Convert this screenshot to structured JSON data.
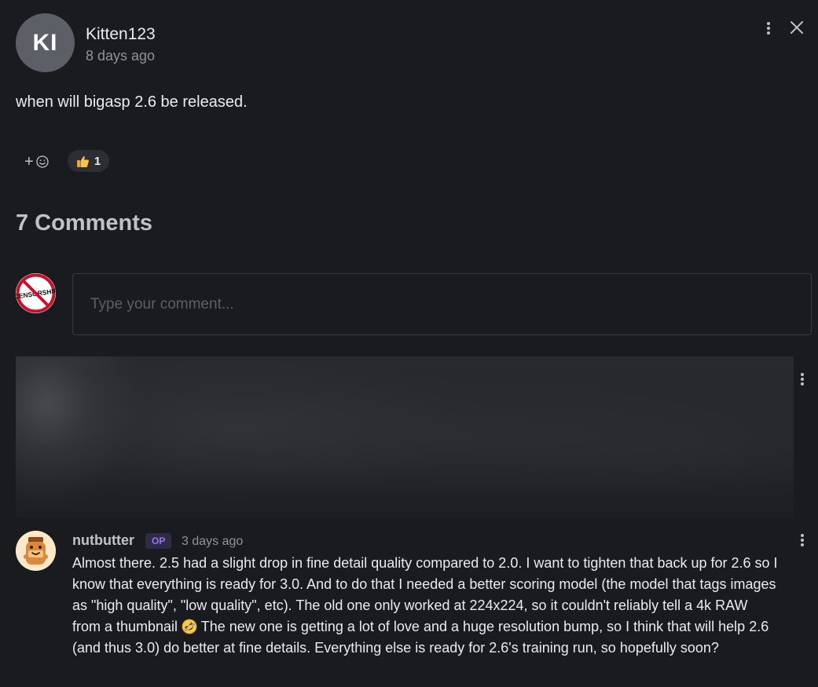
{
  "post": {
    "avatar_initials": "KI",
    "author": "Kitten123",
    "time": "8 days ago",
    "body": "when will bigasp 2.6 be released."
  },
  "reactions": {
    "add_label": "+",
    "items": [
      {
        "emoji": "thumbs-up-icon",
        "count": "1"
      }
    ]
  },
  "comments": {
    "title": "7 Comments",
    "input_placeholder": "Type your comment...",
    "input_value": "",
    "my_avatar_text": "CENSORSHIP"
  },
  "reply": {
    "author": "nutbutter",
    "badge": "OP",
    "time": "3 days ago",
    "body_part1": "Almost there. 2.5 had a slight drop in fine detail quality compared to 2.0. I want to tighten that back up for 2.6 so I know that everything is ready for 3.0. And to do that I needed a better scoring model (the model that tags images as \"high quality\", \"low quality\", etc). The old one only worked at 224x224, so it couldn't reliably tell a 4k RAW from a thumbnail",
    "body_emoji": "rolling-on-floor-laughing-icon",
    "body_part2": " The new one is getting a lot of love and a huge resolution bump, so I think that will help 2.6 (and thus 3.0) do better at fine details. Everything else is ready for 2.6's training run, so hopefully soon?"
  },
  "colors": {
    "background": "#1a1b1e",
    "text": "#c1c2c5",
    "muted": "#909296",
    "op_badge": "#9775fa",
    "chip": "#2c2e33"
  }
}
